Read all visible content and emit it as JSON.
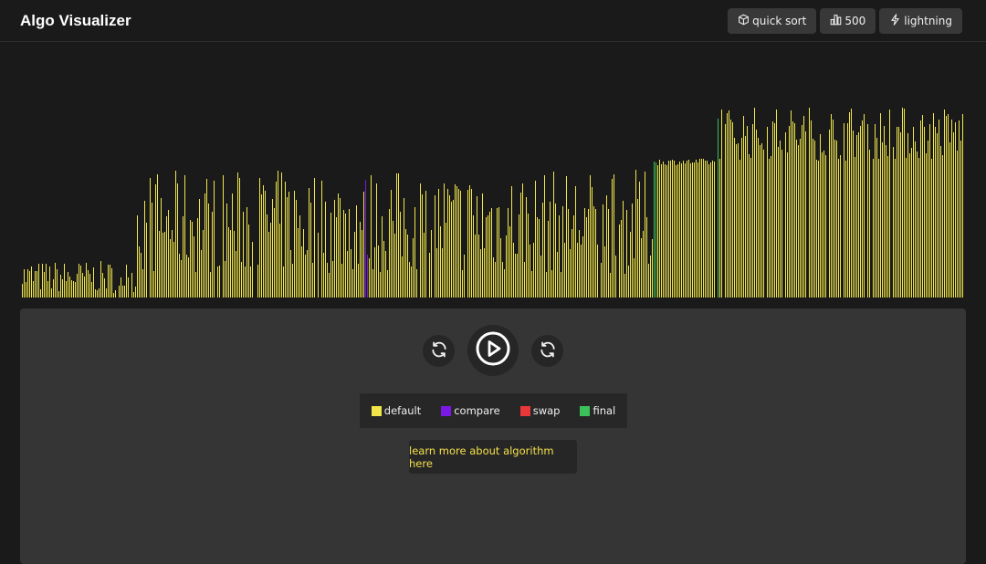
{
  "app": {
    "title": "Algo Visualizer"
  },
  "toolbar": {
    "algorithm_label": "quick sort",
    "algorithm_icon": "cube-icon",
    "size_label": "500",
    "size_icon": "bar-chart-icon",
    "speed_label": "lightning",
    "speed_icon": "lightning-icon"
  },
  "controls": {
    "reset_left_icon": "refresh-icon",
    "play_icon": "play-icon",
    "reset_right_icon": "refresh-icon"
  },
  "legend": [
    {
      "label": "default",
      "color": "#f0e64a"
    },
    {
      "label": "compare",
      "color": "#7b18e6"
    },
    {
      "label": "swap",
      "color": "#e83838"
    },
    {
      "label": "final",
      "color": "#3cc05a"
    }
  ],
  "learn_more": {
    "label": "learn more about algorithm here"
  },
  "colors": {
    "default": "#f0e64a",
    "compare": "#7b18e6",
    "final": "#3cc05a",
    "background": "#1a1a1a",
    "panel": "#353535"
  }
}
